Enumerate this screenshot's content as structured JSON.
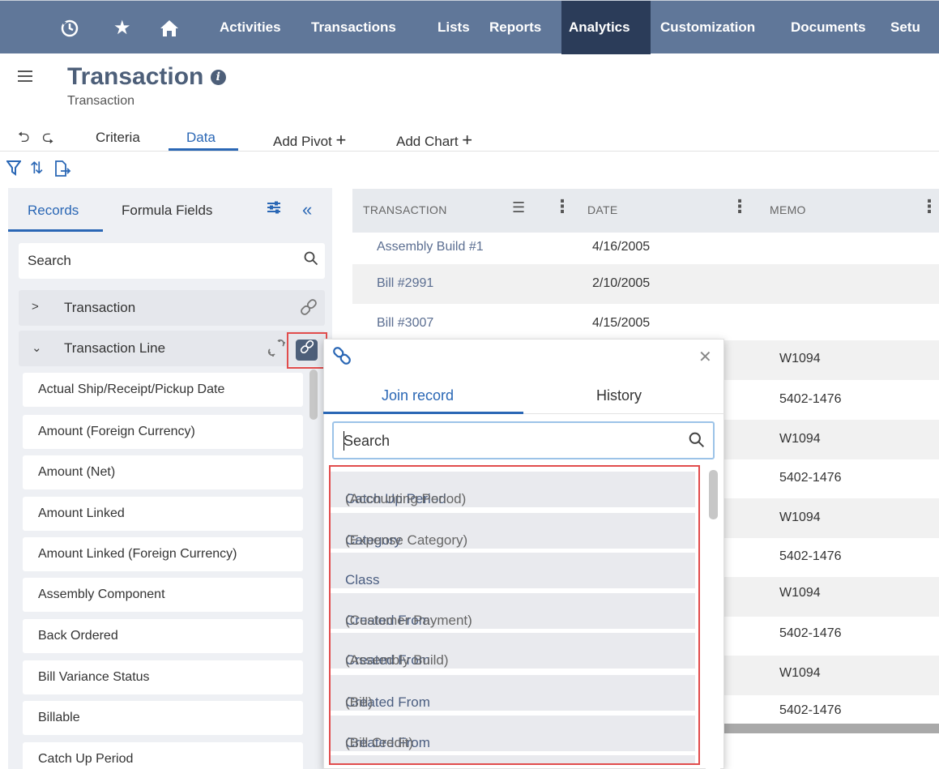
{
  "nav": {
    "items": [
      "Activities",
      "Transactions",
      "Lists",
      "Reports",
      "Analytics",
      "Customization",
      "Documents",
      "Setu"
    ],
    "active": "Analytics",
    "icons": [
      "recent-icon",
      "star-icon",
      "home-icon"
    ]
  },
  "header": {
    "title": "Transaction",
    "subtitle": "Transaction"
  },
  "tabs": {
    "criteria": "Criteria",
    "data": "Data",
    "add_pivot": "Add Pivot",
    "add_chart": "Add Chart"
  },
  "left": {
    "tabs": [
      "Records",
      "Formula Fields"
    ],
    "search_placeholder": "Search",
    "groups": [
      "Transaction",
      "Transaction Line"
    ],
    "fields": [
      "Actual Ship/Receipt/Pickup Date",
      "Amount (Foreign Currency)",
      "Amount (Net)",
      "Amount Linked",
      "Amount Linked (Foreign Currency)",
      "Assembly Component",
      "Back Ordered",
      "Bill Variance Status",
      "Billable",
      "Catch Up Period"
    ]
  },
  "table": {
    "columns": [
      "TRANSACTION",
      "DATE",
      "MEMO"
    ],
    "rows": [
      {
        "transaction": "Assembly Build #1",
        "date": "4/16/2005",
        "memo": ""
      },
      {
        "transaction": "Bill #2991",
        "date": "2/10/2005",
        "memo": ""
      },
      {
        "transaction": "Bill #3007",
        "date": "4/15/2005",
        "memo": ""
      },
      {
        "transaction": "",
        "date": "",
        "memo": "W1094"
      },
      {
        "transaction": "",
        "date": "",
        "memo": "5402-1476"
      },
      {
        "transaction": "",
        "date": "",
        "memo": "W1094"
      },
      {
        "transaction": "",
        "date": "",
        "memo": "5402-1476"
      },
      {
        "transaction": "",
        "date": "",
        "memo": "W1094"
      },
      {
        "transaction": "",
        "date": "",
        "memo": "5402-1476"
      },
      {
        "transaction": "",
        "date": "",
        "memo": "W1094"
      },
      {
        "transaction": "",
        "date": "",
        "memo": "5402-1476"
      },
      {
        "transaction": "",
        "date": "",
        "memo": "W1094"
      },
      {
        "transaction": "",
        "date": "",
        "memo": "5402-1476"
      }
    ]
  },
  "popover": {
    "tabs": [
      "Join record",
      "History"
    ],
    "search_placeholder": "Search",
    "items": [
      {
        "name": "Catch Up Period",
        "sub": "(Accounting Period)"
      },
      {
        "name": "Category",
        "sub": "(Expense Category)"
      },
      {
        "name": "Class",
        "sub": ""
      },
      {
        "name": "Created From",
        "sub": "(Customer Payment)"
      },
      {
        "name": "Created From",
        "sub": "(Assembly Build)"
      },
      {
        "name": "Created From",
        "sub": "(Bill)"
      },
      {
        "name": "Created From",
        "sub": "(Bill Credit)"
      }
    ]
  },
  "colors": {
    "nav_bg": "#607799",
    "nav_active": "#2b3c59",
    "accent": "#2a67b5",
    "highlight": "#e14c4c"
  }
}
